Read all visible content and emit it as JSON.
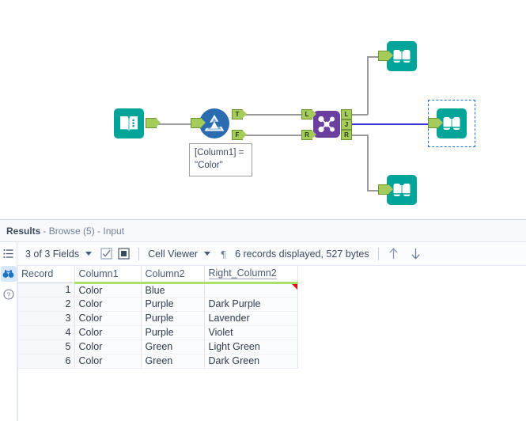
{
  "canvas": {
    "nodes": [
      {
        "id": "input",
        "name": "input-tool",
        "icon": "book-icon"
      },
      {
        "id": "filter",
        "name": "filter-tool",
        "icon": "filter-icon"
      },
      {
        "id": "join",
        "name": "join-tool",
        "icon": "join-icon"
      },
      {
        "id": "browse1",
        "name": "browse-tool-1",
        "icon": "binoculars-icon"
      },
      {
        "id": "browse2",
        "name": "browse-tool-2",
        "icon": "binoculars-icon"
      },
      {
        "id": "browse3",
        "name": "browse-tool-3",
        "icon": "binoculars-icon"
      }
    ],
    "anchors": {
      "filter_true": "T",
      "filter_false": "F",
      "join_in_left": "L",
      "join_in_right": "R",
      "join_out_left": "L",
      "join_out_join": "J",
      "join_out_right": "R"
    },
    "annotation": "[Column1] =\n\"Color\"",
    "colors": {
      "tool_teal": "#00a499",
      "tool_blue": "#2b6cb0",
      "tool_purple": "#6b3fa0",
      "anchor_green": "#a5cc5a",
      "wire": "#9a9a9a",
      "wire_selected": "#3b2fe0",
      "selection_border": "#1c6ed8"
    }
  },
  "results": {
    "header": {
      "title": "Results",
      "subtitle": "- Browse (5) - Input"
    },
    "rail": [
      {
        "name": "list-view-icon",
        "active": false
      },
      {
        "name": "browse-icon",
        "active": true
      },
      {
        "name": "help-icon",
        "active": false
      }
    ],
    "toolbar": {
      "fields_label": "3 of 3 Fields",
      "checkbox_icon": "checkbox-checked-icon",
      "clear_icon": "checkbox-clear-icon",
      "view_label": "Cell Viewer",
      "pilcrow_icon": "pilcrow-icon",
      "records_label": "6 records displayed, 527 bytes",
      "up_icon": "arrow-up-icon",
      "down_icon": "arrow-down-icon"
    },
    "table": {
      "columns": [
        "Record",
        "Column1",
        "Column2",
        "Right_Column2"
      ],
      "rows": [
        {
          "record": "1",
          "column1": "Color",
          "column2": "Blue",
          "right_column2": "",
          "flag": true
        },
        {
          "record": "2",
          "column1": "Color",
          "column2": "Purple",
          "right_column2": "Dark Purple",
          "flag": false
        },
        {
          "record": "3",
          "column1": "Color",
          "column2": "Purple",
          "right_column2": "Lavender",
          "flag": false
        },
        {
          "record": "4",
          "column1": "Color",
          "column2": "Purple",
          "right_column2": "Violet",
          "flag": false
        },
        {
          "record": "5",
          "column1": "Color",
          "column2": "Green",
          "right_column2": "Light Green",
          "flag": false
        },
        {
          "record": "6",
          "column1": "Color",
          "column2": "Green",
          "right_column2": "Dark Green",
          "flag": false
        }
      ]
    }
  }
}
